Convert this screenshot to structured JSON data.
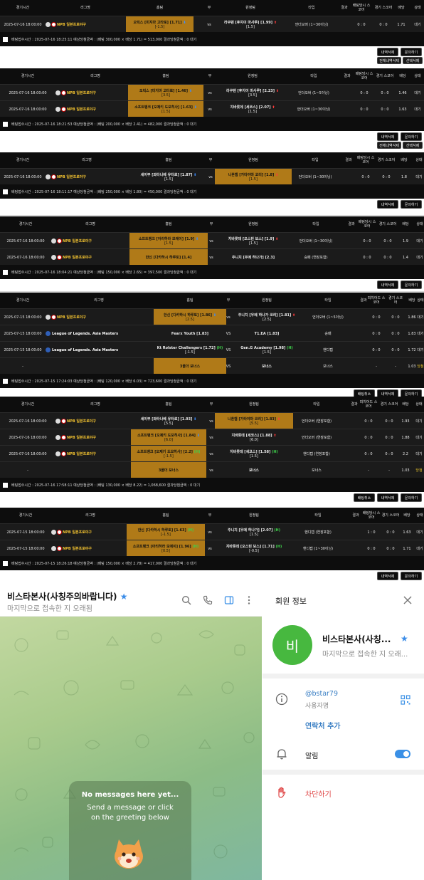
{
  "headers": {
    "a": [
      "경기시간",
      "리그명",
      "홈팀",
      "무",
      "원정팀",
      "타입",
      "결과",
      "배팅당시 스코어",
      "경기 스코어",
      "배당",
      "상태"
    ],
    "b": [
      "경기시간",
      "리그명",
      "홈팀",
      "무",
      "원정팀",
      "타입",
      "결과",
      "피치어드 스코어",
      "경기 스코어",
      "배당",
      "상태"
    ]
  },
  "bets": [
    {
      "rows": [
        {
          "time": "2025-07-16 18:00:00",
          "league": "NPB 일본프로야구",
          "home": "오릭스 [미지마 고타로] [1.71] ⬇",
          "home_line": "[-1.5]",
          "draw": "vs",
          "away": "라쿠텐 [후지이 마사루] [1.99] ⬆",
          "away_line": "[1.5]",
          "type": "언더오버 (1~30이닝)",
          "result": "",
          "bet_score": "0 : 0",
          "game_score": "0 : 0",
          "odds": "1.71",
          "status": "대기"
        }
      ],
      "footer": "배팅접수시간 : 2025-07-16 18:25:11  예상당첨금액 : (배팅 300,000 × 배당 1.71) = 513,000  결과당첨금액 : 0  대기",
      "buttons": [
        "내역삭제",
        "문의하기"
      ],
      "sub_buttons": [
        "전체내역삭제",
        "선택삭제"
      ]
    },
    {
      "rows": [
        {
          "time": "2025-07-16 18:00:00",
          "league": "NPB 일본프로야구",
          "home": "오릭스 [미지마 고타로] [1.46] ⬇",
          "home_line": "[3.5]",
          "draw": "vs",
          "away": "라쿠텐 [후지이 마사루] [2.23] ⬆",
          "away_line": "[3.5]",
          "type": "언더오버 (1~5이닝)",
          "result": "",
          "bet_score": "0 : 0",
          "game_score": "0 : 0",
          "odds": "1.46",
          "status": "대기"
        },
        {
          "time": "2025-07-16 18:00:00",
          "league": "NPB 일본프로야구",
          "home": "소프트뱅크 [오제키 도모히사] [1.63] ⬇",
          "home_line": "[1.5]",
          "draw": "vs",
          "away": "지바롯데 [세코스] [2.07] ⬆",
          "away_line": "[1.5]",
          "type": "언더오버 (1~30이닝)",
          "result": "",
          "bet_score": "0 : 0",
          "game_score": "0 : 0",
          "odds": "1.63",
          "status": "대기"
        }
      ],
      "footer": "배팅접수시간 : 2025-07-16 18:21:53  예상당첨금액 : (배팅 200,000 × 배당 2.41) = 482,000  결과당첨금액 : 0  대기",
      "buttons": [
        "내역삭제",
        "문의하기"
      ],
      "sub_buttons": [
        "전체내역삭제",
        "선택삭제"
      ]
    },
    {
      "rows": [
        {
          "time": "2025-07-16 18:00:00",
          "league": "NPB 일본프로야구",
          "home": "세이부 [와타나베 유타로] [1.87] ⬇",
          "home_line": "[1.5]",
          "draw": "vs",
          "away": "니혼햄 [가타야마 코리] [1.8] ⬆",
          "away_line": "[1.5]",
          "type": "언더오버 (1~30이닝)",
          "result": "",
          "bet_score": "0 : 0",
          "game_score": "0 : 0",
          "odds": "1.8",
          "status": "대기"
        }
      ],
      "footer": "배팅접수시간 : 2025-07-16 18:11:17  예상당첨금액 : (배팅 250,000 × 배당 1.80) = 450,000  결과당첨금액 : 0  대기",
      "buttons": [
        "내역삭제",
        "문의하기"
      ]
    },
    {
      "rows": [
        {
          "time": "2025-07-16 18:00:00",
          "league": "NPB 일본프로야구",
          "home": "소프트뱅크 [아리하라 모에이] [1.9] ⬇",
          "home_line": "[1.5]",
          "draw": "vs",
          "away": "지바롯데 [오스틴 보스] [1.9] ⬆",
          "away_line": "[1.5]",
          "type": "언더오버 (1~30이닝)",
          "result": "",
          "bet_score": "0 : 0",
          "game_score": "0 : 0",
          "odds": "1.9",
          "status": "대기"
        },
        {
          "time": "2025-07-16 18:00:00",
          "league": "NPB 일본프로야구",
          "home": "한신 [다카하시 하루토] [1.4]",
          "home_line": "",
          "draw": "vs",
          "away": "주니치 [우메 하나가] [2.3]",
          "away_line": "",
          "type": "승패 (연장포함)",
          "result": "",
          "bet_score": "0 : 0",
          "game_score": "0 : 0",
          "odds": "1.4",
          "status": "대기"
        }
      ],
      "footer": "배팅접수시간 : 2025-07-16 18:04:21  예상당첨금액 : (배팅 150,000 × 배당 2.65) = 397,500  결과당첨금액 : 0  대기",
      "buttons": [
        "내역삭제",
        "문의하기"
      ]
    },
    {
      "rows": [
        {
          "time": "2025-07-15 18:00:00",
          "league": "NPB 일본프로야구",
          "home": "한신 [다카하시 하루토] [1.86] ⬇",
          "home_line": "[2.5]",
          "draw": "vs",
          "away": "주니치 [우메 하나가 코리] [1.81] ⬆",
          "away_line": "[2.5]",
          "type": "언더오버 (1~5이닝)",
          "result": "",
          "bet_score": "0 : 0",
          "game_score": "0 : 0",
          "odds": "1.86",
          "status": "대기"
        },
        {
          "time": "2025-07-15 18:00:00",
          "league": "League of Legends. Asia Masters",
          "home": "Fearx Youth [1.83]",
          "home_line": "",
          "draw": "VS",
          "away": "T1.EA [1.83]",
          "away_line": "",
          "type": "승패",
          "result": "",
          "bet_score": "0 : 0",
          "game_score": "0 : 0",
          "odds": "1.83",
          "status": "대기"
        },
        {
          "time": "2025-07-15 18:00:00",
          "league": "League of Legends. Asia Masters",
          "home": "Kt Rolster Challengers [1.72] (H)",
          "home_line": "[-1.5]",
          "draw": "VS",
          "away": "Gen.G Academy [1.98] (H)",
          "away_line": "[1.5]",
          "type": "핸디캡",
          "result": "",
          "bet_score": "0 : 0",
          "game_score": "0 : 0",
          "odds": "1.72",
          "status": "대기"
        },
        {
          "time": "-",
          "league": "",
          "home": "3폴더 보너스",
          "home_line": "",
          "draw": "VS",
          "away": "보너스",
          "away_line": "",
          "type": "보너스",
          "result": "",
          "bet_score": "-",
          "game_score": "-",
          "odds": "1.03",
          "status": "당첨"
        }
      ],
      "footer": "배팅접수시간 : 2025-07-15 17:24:03  예상당첨금액 : (배팅 120,000 × 배당 6.03) = 723,600  결과당첨금액 : 0  대기",
      "buttons": [
        "배팅취소",
        "내역삭제",
        "문의하기"
      ]
    },
    {
      "rows": [
        {
          "time": "2025-07-16 18:00:00",
          "league": "NPB 일본프로야구",
          "home": "세이부 [와타나베 유타로] [1.93] ⬇",
          "home_line": "[5.5]",
          "draw": "vs",
          "away": "니혼햄 [가타야마 코리] [1.83] ⬆",
          "away_line": "[5.5]",
          "type": "언더오버 (연장포함)",
          "result": "",
          "bet_score": "0 : 0",
          "game_score": "0 : 0",
          "odds": "1.93",
          "status": "대기"
        },
        {
          "time": "2025-07-16 18:00:00",
          "league": "NPB 일본프로야구",
          "home": "소프트뱅크 [오제키 도모히사] [1.84] ⬇",
          "home_line": "[6.0]",
          "draw": "vs",
          "away": "지바롯데 [세코스] [1.88] ⬆",
          "away_line": "[6.0]",
          "type": "언더오버 (연장포함)",
          "result": "",
          "bet_score": "0 : 0",
          "game_score": "0 : 0",
          "odds": "1.88",
          "status": "대기"
        },
        {
          "time": "2025-07-16 18:00:00",
          "league": "NPB 일본프로야구",
          "home": "소프트뱅크 [오제키 도모히사] [2.2] (H)",
          "home_line": "[-1.5]",
          "draw": "vs",
          "away": "지바롯데 [세코스] [1.58] (H)",
          "away_line": "[1.5]",
          "type": "핸디캡 (연장포함)",
          "result": "",
          "bet_score": "0 : 0",
          "game_score": "0 : 0",
          "odds": "2.2",
          "status": "대기"
        },
        {
          "time": "-",
          "league": "",
          "home": "3폴더 보너스",
          "home_line": "",
          "draw": "vs",
          "away": "보너스",
          "away_line": "",
          "type": "보너스",
          "result": "",
          "bet_score": "-",
          "game_score": "-",
          "odds": "1.03",
          "status": "당첨"
        }
      ],
      "footer": "배팅접수시간 : 2025-07-16 17:58:11  예상당첨금액 : (배팅 130,000 × 배당 8.22) = 1,068,600  결과당첨금액 : 0  대기",
      "buttons": [
        "배팅취소",
        "내역삭제",
        "문의하기"
      ]
    },
    {
      "rows": [
        {
          "time": "2025-07-15 18:00:00",
          "league": "NPB 일본프로야구",
          "home": "한신 [다카하시 하루토] [1.63] (H)",
          "home_line": "[-1.5]",
          "draw": "vs",
          "away": "주니치 [우메 하나가] [2.07] (H)",
          "away_line": "[1.5]",
          "type": "핸디캡 (연장포함)",
          "result": "",
          "bet_score": "1 : 0",
          "game_score": "0 : 0",
          "odds": "1.63",
          "status": "대기"
        },
        {
          "time": "2025-07-15 18:00:00",
          "league": "NPB 일본프로야구",
          "home": "소프트뱅크 [아리하라 모에이] [1.96] (H)",
          "home_line": "[0.5]",
          "draw": "vs",
          "away": "지바롯데 [오스틴 보스] [1.71] (H)",
          "away_line": "[-0.5]",
          "type": "핸디캡 (1~30이닝)",
          "result": "",
          "bet_score": "0 : 0",
          "game_score": "0 : 0",
          "odds": "1.71",
          "status": "대기"
        }
      ],
      "footer": "배팅접수시간 : 2025-07-15 18:26:18  예상당첨금액 : (배팅 150,000 × 배당 2.78) = 417,000  결과당첨금액 : 0  대기",
      "buttons": [
        "내역삭제",
        "문의하기"
      ]
    }
  ],
  "telegram": {
    "chat_title": "비스타본사(사칭주의바랍니다)",
    "chat_status": "마지막으로 접속한 지 오래됨",
    "empty_title": "No messages here yet...",
    "empty_sub": "Send a message or click on the greeting below",
    "panel_title": "회원 정보",
    "avatar_letter": "비",
    "profile_name": "비스타본사(사칭...",
    "profile_status": "마지막으로 접속한 지 오래...",
    "username": "@bstar79",
    "username_label": "사용자명",
    "add_contact": "연락처 추가",
    "notifications": "알림",
    "block": "차단하기",
    "accent_color": "#3a90e6",
    "avatar_color": "#47b83f",
    "icons": [
      "search-icon",
      "phone-icon",
      "sidebar-icon",
      "more-icon",
      "close-icon",
      "info-icon",
      "qr-icon",
      "bell-icon",
      "hand-icon",
      "star-icon"
    ]
  }
}
